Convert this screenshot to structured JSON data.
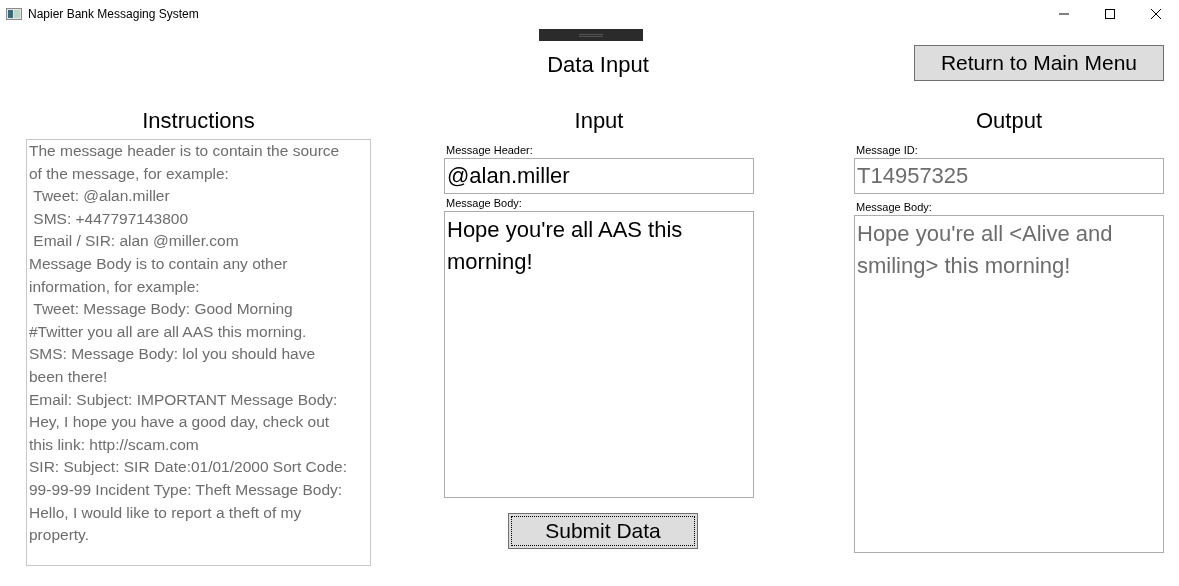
{
  "window": {
    "title": "Napier Bank Messaging System"
  },
  "page": {
    "title": "Data Input",
    "return_button": "Return to Main Menu"
  },
  "instructions": {
    "heading": "Instructions",
    "text": "The message header is to contain the source of the message, for example:\n Tweet: @alan.miller\n SMS: +447797143800\n Email / SIR: alan @miller.com\nMessage Body is to contain any other information, for example:\n Tweet: Message Body: Good Morning #Twitter you all are all AAS this morning.\nSMS: Message Body: lol you should have been there!\nEmail: Subject: IMPORTANT Message Body: Hey, I hope you have a good day, check out this link: http://scam.com\nSIR: Subject: SIR Date:01/01/2000 Sort Code: 99-99-99 Incident Type: Theft Message Body: Hello, I would like to report a theft of my property.",
    "disabled": true
  },
  "input": {
    "heading": "Input",
    "fields": [
      {
        "label": "Message Header:",
        "value": "@alan.miller",
        "kind": "line",
        "disabled": false
      },
      {
        "label": "Message Body:",
        "value": "Hope you're all AAS this morning!",
        "kind": "area",
        "disabled": false
      }
    ],
    "submit_button": "Submit Data"
  },
  "output": {
    "heading": "Output",
    "fields": [
      {
        "label": "Message ID:",
        "value": "T14957325",
        "kind": "line",
        "disabled": true
      },
      {
        "label": "Message Body:",
        "value": "Hope you're all <Alive and smiling> this morning!",
        "kind": "area",
        "disabled": true
      }
    ]
  }
}
